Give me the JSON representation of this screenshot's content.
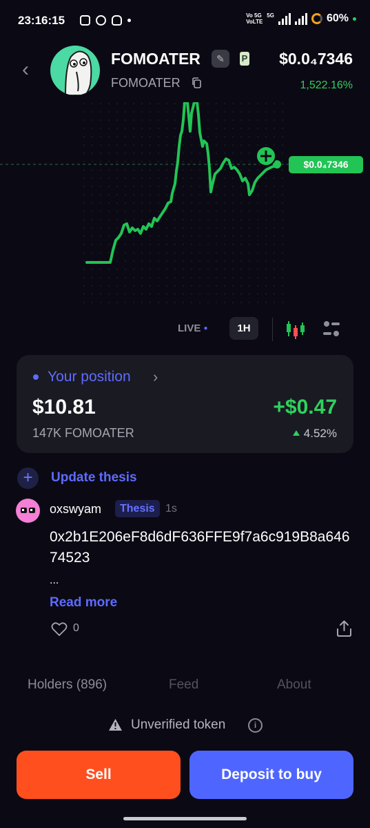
{
  "status_bar": {
    "time": "23:16:15",
    "net_top": "Vo 5G",
    "net_bottom": "VoLTE",
    "net_5g": "5G",
    "battery": "60%",
    "icons": [
      "instagram-icon",
      "chat-icon",
      "discord-icon",
      "dot-icon",
      "signal-icon",
      "battery-icon"
    ]
  },
  "header": {
    "token_name": "FOMOATER",
    "ticker": "FOMOATER",
    "price": "$0.0₄7346",
    "change": "1,522.16%",
    "badge_letter": "P",
    "colors": {
      "positive": "#2fd15d",
      "avatar_bg": "#4bd9a4"
    }
  },
  "chart": {
    "price_tag": "$0.0₄7346",
    "line_color": "#22c455"
  },
  "chart_controls": {
    "live_label": "LIVE",
    "timeframe": "1H"
  },
  "position": {
    "title": "Your position",
    "value": "$10.81",
    "quantity": "147K FOMOATER",
    "pnl": "+$0.47",
    "pnl_pct": "4.52%"
  },
  "thesis": {
    "update_label": "Update thesis",
    "username": "oxswyam",
    "badge": "Thesis",
    "time_ago": "1s",
    "text": "0x2b1E206eF8d6dF636FFE9f7a6c919B8a64674523",
    "ellipsis": "...",
    "read_more": "Read more",
    "likes": "0"
  },
  "tabs": {
    "holders": "Holders (896)",
    "feed": "Feed",
    "about": "About"
  },
  "notice": {
    "text": "Unverified token"
  },
  "actions": {
    "sell_label": "Sell",
    "buy_label": "Deposit to buy",
    "colors": {
      "sell": "#ff4f1f",
      "buy": "#4e66ff"
    }
  }
}
